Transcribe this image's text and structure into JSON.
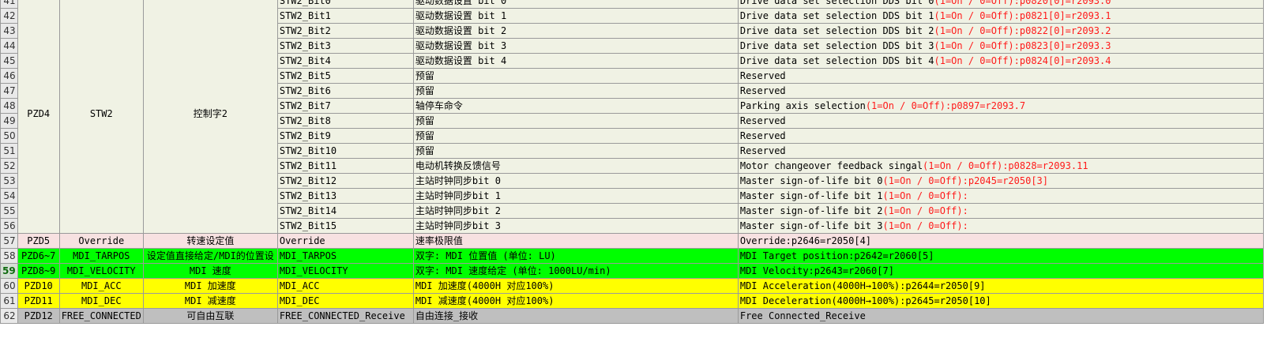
{
  "sheet": {
    "pzd4_group": {
      "pzd": "PZD4",
      "name": "STW2",
      "desc": "控制字2"
    },
    "bit_rows": [
      {
        "rownum": "41",
        "signal": "STW2_Bit0",
        "cn": "驱动数据设置 bit 0",
        "en": "Drive data set selection DDS bit 0",
        "en_red": "(1=On / 0=Off):p0820[0]=r2093.0"
      },
      {
        "rownum": "42",
        "signal": "STW2_Bit1",
        "cn": "驱动数据设置 bit 1",
        "en": "Drive data set selection DDS bit 1",
        "en_red": "(1=On / 0=Off):p0821[0]=r2093.1"
      },
      {
        "rownum": "43",
        "signal": "STW2_Bit2",
        "cn": "驱动数据设置 bit 2",
        "en": "Drive data set selection DDS bit 2",
        "en_red": "(1=On / 0=Off):p0822[0]=r2093.2"
      },
      {
        "rownum": "44",
        "signal": "STW2_Bit3",
        "cn": "驱动数据设置 bit 3",
        "en": "Drive data set selection DDS bit 3",
        "en_red": "(1=On / 0=Off):p0823[0]=r2093.3"
      },
      {
        "rownum": "45",
        "signal": "STW2_Bit4",
        "cn": "驱动数据设置 bit 4",
        "en": "Drive data set selection DDS bit 4",
        "en_red": "(1=On / 0=Off):p0824[0]=r2093.4"
      },
      {
        "rownum": "46",
        "signal": "STW2_Bit5",
        "cn": "预留",
        "en": "Reserved",
        "en_red": ""
      },
      {
        "rownum": "47",
        "signal": "STW2_Bit6",
        "cn": "预留",
        "en": "Reserved",
        "en_red": ""
      },
      {
        "rownum": "48",
        "signal": "STW2_Bit7",
        "cn": "轴停车命令",
        "en": "Parking axis selection",
        "en_red": "(1=On / 0=Off):p0897=r2093.7"
      },
      {
        "rownum": "49",
        "signal": "STW2_Bit8",
        "cn": "预留",
        "en": "Reserved",
        "en_red": ""
      },
      {
        "rownum": "50",
        "signal": "STW2_Bit9",
        "cn": "预留",
        "en": "Reserved",
        "en_red": ""
      },
      {
        "rownum": "51",
        "signal": "STW2_Bit10",
        "cn": "预留",
        "en": "Reserved",
        "en_red": ""
      },
      {
        "rownum": "52",
        "signal": "STW2_Bit11",
        "cn": "电动机转换反馈信号",
        "en": "Motor changeover feedback singal",
        "en_red": "(1=On / 0=Off):p0828=r2093.11"
      },
      {
        "rownum": "53",
        "signal": "STW2_Bit12",
        "cn": "主站时钟同步bit 0",
        "en": "Master sign-of-life bit 0",
        "en_red": "(1=On / 0=Off):p2045=r2050[3]"
      },
      {
        "rownum": "54",
        "signal": "STW2_Bit13",
        "cn": "主站时钟同步bit 1",
        "en": "Master sign-of-life bit 1",
        "en_red": "(1=On / 0=Off):"
      },
      {
        "rownum": "55",
        "signal": "STW2_Bit14",
        "cn": "主站时钟同步bit 2",
        "en": "Master sign-of-life bit 2",
        "en_red": "(1=On / 0=Off):"
      },
      {
        "rownum": "56",
        "signal": "STW2_Bit15",
        "cn": "主站时钟同步bit 3",
        "en": "Master sign-of-life bit 3",
        "en_red": "(1=On / 0=Off):"
      }
    ],
    "bottom_rows": [
      {
        "rownum": "57",
        "pzd": "PZD5",
        "name": "Override",
        "desc": "转速设定值",
        "signal": "Override",
        "cn": "速率极限值",
        "en": "Override:p2646=r2050[4]"
      },
      {
        "rownum": "58",
        "pzd": "PZD6~7",
        "name": "MDI_TARPOS",
        "desc": "设定值直接给定/MDI的位置设",
        "signal": "MDI_TARPOS",
        "cn": "双字: MDI 位置值 (单位: LU)",
        "en": "MDI Target position:p2642=r2060[5]"
      },
      {
        "rownum": "59",
        "pzd": "PZD8~9",
        "name": "MDI_VELOCITY",
        "desc": "MDI 速度",
        "signal": "MDI_VELOCITY",
        "cn": "双字: MDI 速度给定 (单位: 1000LU/min)",
        "en": "MDI Velocity:p2643=r2060[7]"
      },
      {
        "rownum": "60",
        "pzd": "PZD10",
        "name": "MDI_ACC",
        "desc": "MDI 加速度",
        "signal": "MDI_ACC",
        "cn": "MDI 加速度(4000H 对应100%)",
        "en": "MDI Acceleration(4000H→100%):p2644=r2050[9]"
      },
      {
        "rownum": "61",
        "pzd": "PZD11",
        "name": "MDI_DEC",
        "desc": "MDI 减速度",
        "signal": "MDI_DEC",
        "cn": "MDI 减速度(4000H 对应100%)",
        "en": "MDI Deceleration(4000H→100%):p2645=r2050[10]"
      },
      {
        "rownum": "62",
        "pzd": "PZD12",
        "name": "FREE_CONNECTED",
        "desc": "可自由互联",
        "signal": "FREE_CONNECTED_Receive",
        "cn": "自由连接_接收",
        "en": "Free Connected_Receive"
      }
    ],
    "colors": {
      "beige": "#f0f2e4",
      "pink": "#f7e1e1",
      "green": "#00ff00",
      "yellow": "#ffff00",
      "gray": "#bfbfbf",
      "red_text": "#ff1a1a"
    }
  }
}
